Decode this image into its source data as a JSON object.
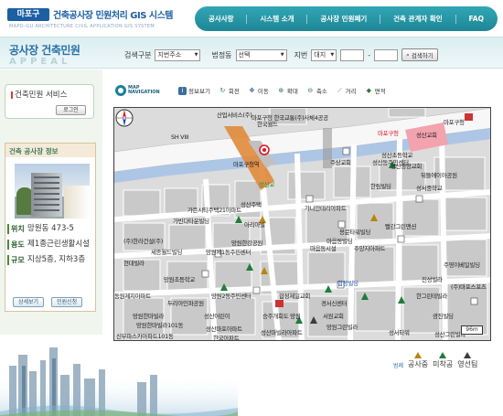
{
  "header": {
    "logo_badge": "마포구",
    "logo_title": "건축공사장 민원처리 GIS 시스템",
    "logo_subtitle": "MAPO-GU ARCHITECTURE CIVIL APPLICATION GIS SYSTEM",
    "nav": [
      "공사사항",
      "시스템 소개",
      "공사장 민원페기",
      "건축 관계자 확인",
      "FAQ"
    ]
  },
  "page": {
    "title": "공사장 건축민원",
    "title_sub": "APPEAL"
  },
  "search": {
    "category_label": "검색구분",
    "category_value": "지번주소",
    "dong_label": "법정동",
    "dong_value": "선택",
    "jibun_label": "지번",
    "jibun_type": "대지",
    "jibun_sep": "-",
    "search_button": "검색하기"
  },
  "sidebar": {
    "civil_title": "건축민원 서비스",
    "login_button": "로그인",
    "info_title": "건축 공사장 정보",
    "rows": [
      {
        "key": "위치",
        "value": "망원동 473-5"
      },
      {
        "key": "용도",
        "value": "제1종근린생활시설"
      },
      {
        "key": "규모",
        "value": "지상5층, 지하3층"
      }
    ],
    "detail_button": "상세보기",
    "apply_button": "민원신청"
  },
  "map_nav": {
    "logo_line1": "MAP",
    "logo_line2": "NAVIGATION"
  },
  "toolbar": {
    "tools": [
      {
        "icon": "info-icon",
        "label": "정보보기"
      },
      {
        "icon": "rotate-icon",
        "label": "회전"
      },
      {
        "icon": "move-icon",
        "label": "이동"
      },
      {
        "icon": "zoom-in-icon",
        "label": "확대"
      },
      {
        "icon": "zoom-out-icon",
        "label": "축소"
      },
      {
        "icon": "distance-icon",
        "label": "거리"
      },
      {
        "icon": "area-icon",
        "label": "면적"
      }
    ]
  },
  "map": {
    "labels": {
      "l1": "산업서비스(주)",
      "l2": "마포구청 한국교통(주)사체4공공",
      "l3": "한국월드",
      "l4": "SH VIII",
      "l5": "마포구청역",
      "l6": "성산교",
      "l7": "마포구청",
      "l8": "성산교회",
      "l9": "주상교회",
      "l10": "성산초등학교",
      "l11": "성산중앙교회",
      "l12": "성산동주민센터",
      "l13": "뒤뜰에이아공원",
      "l14": "성서중학교",
      "l15": "한림빌딩",
      "l16": "성산주택",
      "l17": "가든시티주택21아파트",
      "l18": "가빈다타운빌딩",
      "l19": "아리아빌",
      "l20": "가나안테리아파트",
      "l21": "(주)한라건설(주)",
      "l22": "빨강그린맨션",
      "l23": "망원한강공원",
      "l24": "세종월드빌딩",
      "l25": "망원제1동주민센터",
      "l26": "용문타워빌딩",
      "l27": "마음동빌딩",
      "l28": "주양지아파트",
      "l29": "마음동시설",
      "l30": "합정빌딩",
      "l31": "진성빌라",
      "l32": "주영이베일빌딩",
      "l33": "망원초등학교",
      "l34": "현대빌라",
      "l35": "동원제지아파트",
      "l36": "두리아인파공원",
      "l37": "망원2동주민센터",
      "l38": "합정제일교회",
      "l39": "경서신센터",
      "l40": "한그린테빌라",
      "l41": "망원한마빌라",
      "l42": "성산어린이",
      "l43": "서원교회",
      "l44": "광진빌딩",
      "l45": "망원한마빌라101동",
      "l46": "성산마포아파트",
      "l47": "승주개회도 망원",
      "l48": "신부파스카아파트101동",
      "l49": "한국아파트",
      "l50": "성산마빌라아파트",
      "l51": "망원그린빌라",
      "l52": "(주)마포스포츠",
      "l53": "성산그린빌라",
      "l54": "성서타워",
      "l55": "마포구청"
    },
    "scale": "96m"
  },
  "legend": {
    "title": "범례",
    "items": [
      {
        "label": "공사중",
        "color": "#b8860b"
      },
      {
        "label": "미착공",
        "color": "#1e7d3a"
      },
      {
        "label": "영선팀",
        "color": "#3c3c3c"
      }
    ]
  }
}
